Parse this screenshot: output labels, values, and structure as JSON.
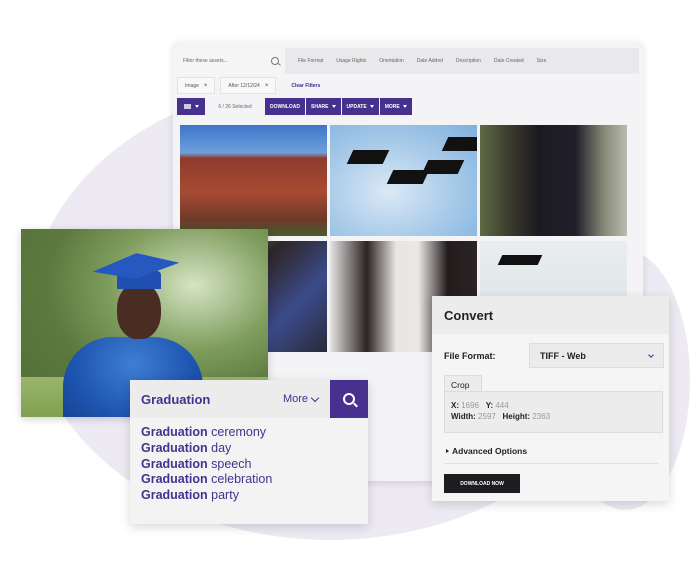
{
  "asset_panel": {
    "filter_placeholder": "Filter these assets...",
    "filter_columns": [
      "File Format",
      "Usage Rights",
      "Orientation",
      "Date Added",
      "Description",
      "Date Created",
      "Size"
    ],
    "chips": [
      {
        "label": "Image",
        "remove": "×"
      },
      {
        "label": "After 12/12/24",
        "remove": "×"
      }
    ],
    "clear_filters": "Clear Filters",
    "selected_count": "6 / 26 Selected",
    "buttons": {
      "download": "DOWNLOAD",
      "share": "SHARE",
      "update": "UPDATE",
      "more": "MORE"
    },
    "tiles": [
      {
        "subject": "Ivy-covered university building"
      },
      {
        "subject": "Graduation caps thrown in the air"
      },
      {
        "subject": "Smiling graduate in gown with stole"
      },
      {
        "subject": "Graduates in circle from below"
      },
      {
        "subject": "Graduates shaking hands with diplomas"
      },
      {
        "subject": "Graduate speaking at podium"
      }
    ]
  },
  "featured_photo": {
    "subject": "Smiling graduate in blue cap and gown"
  },
  "search": {
    "term": "Graduation",
    "more_label": "More",
    "suggestions": [
      {
        "bold": "Graduation",
        "rest": "ceremony"
      },
      {
        "bold": "Graduation",
        "rest": "day"
      },
      {
        "bold": "Graduation",
        "rest": "speech"
      },
      {
        "bold": "Graduation",
        "rest": "celebration"
      },
      {
        "bold": "Graduation",
        "rest": "party"
      }
    ]
  },
  "convert": {
    "title": "Convert",
    "file_format_label": "File Format:",
    "file_format_value": "TIFF - Web",
    "crop_tab": "Crop",
    "crop": {
      "x_label": "X:",
      "x": "1696",
      "y_label": "Y:",
      "y": "444",
      "width_label": "Width:",
      "width": "2597",
      "height_label": "Height:",
      "height": "2363"
    },
    "advanced_options": "Advanced Options",
    "download_now": "DOWNLOAD NOW"
  },
  "colors": {
    "brand_purple": "#46318f",
    "background_blob": "#eeeaf4",
    "dark_button": "#1d1d21"
  }
}
